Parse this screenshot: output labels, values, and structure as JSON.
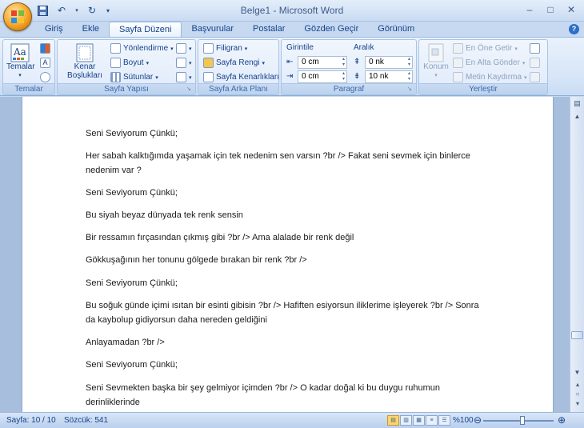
{
  "window": {
    "title": "Belge1 - Microsoft Word"
  },
  "quick_access": {
    "save": "save-icon",
    "undo": "undo-icon",
    "redo": "redo-icon"
  },
  "tabs": [
    {
      "label": "Giriş"
    },
    {
      "label": "Ekle"
    },
    {
      "label": "Sayfa Düzeni"
    },
    {
      "label": "Başvurular"
    },
    {
      "label": "Postalar"
    },
    {
      "label": "Gözden Geçir"
    },
    {
      "label": "Görünüm"
    }
  ],
  "ribbon": {
    "temalar": {
      "group_label": "Temalar",
      "themes_button": "Temalar"
    },
    "sayfa_yapisi": {
      "group_label": "Sayfa Yapısı",
      "margins": "Kenar Boşlukları",
      "orientation": "Yönlendirme",
      "size": "Boyut",
      "columns": "Sütunlar"
    },
    "sayfa_arka_plani": {
      "group_label": "Sayfa Arka Planı",
      "watermark": "Filigran",
      "page_color": "Sayfa Rengi",
      "page_borders": "Sayfa Kenarlıkları"
    },
    "paragraf": {
      "group_label": "Paragraf",
      "indent_label": "Girintile",
      "spacing_label": "Aralık",
      "indent_left": "0 cm",
      "indent_right": "0 cm",
      "spacing_before": "0 nk",
      "spacing_after": "10 nk"
    },
    "yerlestir": {
      "group_label": "Yerleştir",
      "position": "Konum",
      "bring_front": "En Öne Getir",
      "send_back": "En Alta Gönder",
      "text_wrap": "Metin Kaydırma"
    }
  },
  "document": {
    "paragraphs": [
      "Seni Seviyorum Çünkü;",
      "Her sabah kalktığımda yaşamak için tek nedenim sen varsın ?br /> Fakat seni sevmek için binlerce nedenim var ?",
      "Seni Seviyorum Çünkü;",
      "Bu siyah beyaz dünyada tek renk sensin",
      "Bir ressamın fırçasından çıkmış gibi ?br /> Ama alalade  bir renk değil",
      "Gökkuşağının her tonunu gölgede bırakan bir renk ?br />",
      "Seni Seviyorum Çünkü;",
      "Bu soğuk günde içimi ısıtan bir esinti gibisin ?br /> Hafiften esiyorsun iliklerime işleyerek ?br /> Sonra da kaybolup gidiyorsun daha nereden geldiğini",
      "Anlayamadan ?br />",
      "Seni Seviyorum Çünkü;",
      "Seni Sevmekten başka bir şey gelmiyor içimden ?br /> O kadar doğal ki bu duygu ruhumun derinliklerinde"
    ]
  },
  "status": {
    "page": "Sayfa: 10 / 10",
    "words": "Sözcük: 541",
    "zoom": "%100"
  }
}
